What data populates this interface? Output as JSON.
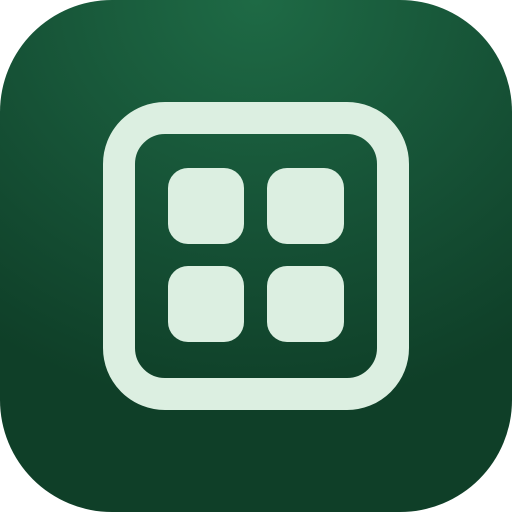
{
  "icon": {
    "name": "grid-apps-icon",
    "colors": {
      "background_top": "#1e6a45",
      "background_mid": "#165236",
      "background_bottom": "#0f3f28",
      "glyph": "#dcefe1"
    }
  }
}
